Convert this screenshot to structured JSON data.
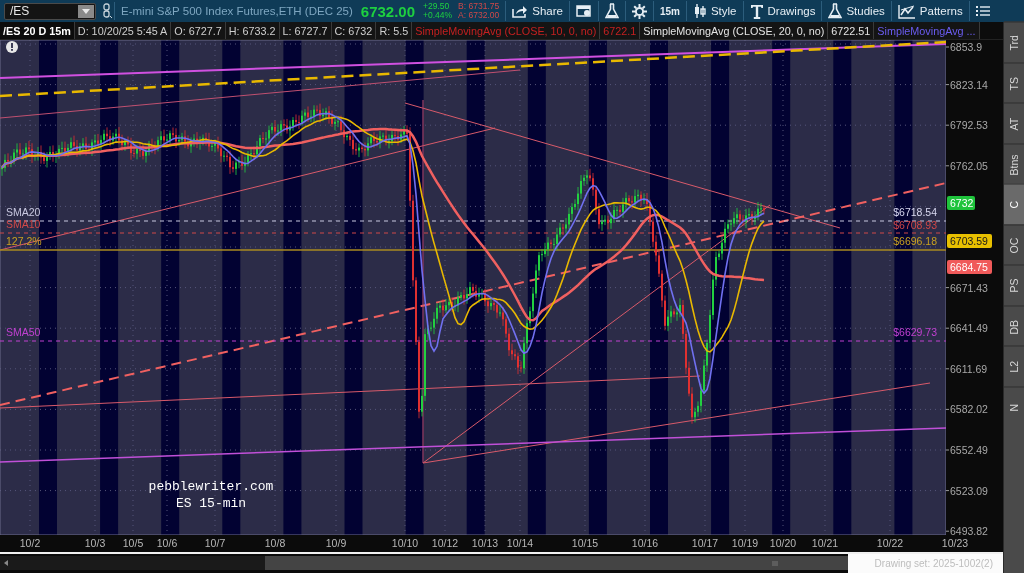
{
  "toolbar": {
    "symbol": "/ES",
    "description": "E-mini S&P 500 Index Futures,ETH (DEC 25)",
    "last": "6732.00",
    "change": "+29.50",
    "change_pct": "+0.44%",
    "bid": "B: 6731.75",
    "ask": "A: 6732.00",
    "buttons": [
      {
        "kind": "share",
        "label": "Share"
      },
      {
        "kind": "window"
      },
      {
        "kind": "flask"
      },
      {
        "kind": "gear"
      },
      {
        "kind": "interval",
        "label": "15m"
      },
      {
        "kind": "style",
        "label": "Style"
      },
      {
        "kind": "drawings",
        "label": "Drawings"
      },
      {
        "kind": "studies",
        "label": "Studies"
      },
      {
        "kind": "patterns",
        "label": "Patterns"
      },
      {
        "kind": "menu"
      }
    ]
  },
  "info_bar": {
    "cells": [
      {
        "kind": "title",
        "text": "/ES 20 D 15m"
      },
      {
        "kind": "plain",
        "text": "D: 10/20/25 5:45 A"
      },
      {
        "kind": "plain",
        "text": "O: 6727.7"
      },
      {
        "kind": "plain",
        "text": "H: 6733.2"
      },
      {
        "kind": "plain",
        "text": "L: 6727.7"
      },
      {
        "kind": "plain",
        "text": "C: 6732"
      },
      {
        "kind": "plain",
        "text": "R: 5.5"
      },
      {
        "kind": "study",
        "text": "SimpleMovingAvg (CLOSE, 10, 0, no)"
      },
      {
        "kind": "study",
        "text": "6722.1"
      },
      {
        "kind": "study",
        "text": "SimpleMovingAvg (CLOSE, 20, 0, no)"
      },
      {
        "kind": "study",
        "text": "6722.51"
      },
      {
        "kind": "study",
        "text": "SimpleMovingAvg ..."
      }
    ]
  },
  "chart": {
    "level_labels": [
      {
        "text": "SMA20",
        "color": "#c8c8e0"
      },
      {
        "text": "SMA10",
        "color": "#d04848"
      },
      {
        "text": "127.2%",
        "color": "#c8a020"
      },
      {
        "text": "SMA50",
        "color": "#c040d0"
      }
    ],
    "price_tags": [
      {
        "text": "$6718.54",
        "color": "#d8d8f0"
      },
      {
        "text": "$6708.93",
        "color": "#d04848"
      },
      {
        "text": "$6696.18",
        "color": "#c8a020"
      },
      {
        "text": "$6629.73",
        "color": "#c040d0"
      }
    ],
    "notes": [
      "pebblewriter.com",
      "ES 15-min"
    ]
  },
  "price_axis": {
    "labels": [
      "6853.9",
      "6823.14",
      "6792.53",
      "6762.05",
      "6671.43",
      "6641.49",
      "6611.69",
      "6582.02",
      "6552.49",
      "6523.09",
      "6493.82"
    ],
    "badges": [
      {
        "text": "6732",
        "color": "#1fc43c"
      },
      {
        "text": "6703.59",
        "color": "#e8c000"
      },
      {
        "text": "6684.75",
        "color": "#f05a5a"
      }
    ]
  },
  "date_axis": {
    "labels": [
      "10/2",
      "10/3",
      "10/5",
      "10/6",
      "10/7",
      "10/8",
      "10/9",
      "10/10",
      "10/12",
      "10/13",
      "10/14",
      "10/15",
      "10/16",
      "10/17",
      "10/19",
      "10/20",
      "10/21",
      "10/22",
      "10/23"
    ]
  },
  "sidebar": {
    "tabs": [
      {
        "label": "Trd",
        "selected": false
      },
      {
        "label": "TS",
        "selected": false
      },
      {
        "label": "AT",
        "selected": false
      },
      {
        "label": "Btns",
        "selected": false
      },
      {
        "label": "C",
        "selected": true
      },
      {
        "label": "OC",
        "selected": false
      },
      {
        "label": "PS",
        "selected": false
      },
      {
        "label": "DB",
        "selected": false
      },
      {
        "label": "L2",
        "selected": false
      },
      {
        "label": "N",
        "selected": false
      }
    ]
  },
  "status": {
    "drawing_set": "Drawing set: 2025-1002(2)"
  }
}
